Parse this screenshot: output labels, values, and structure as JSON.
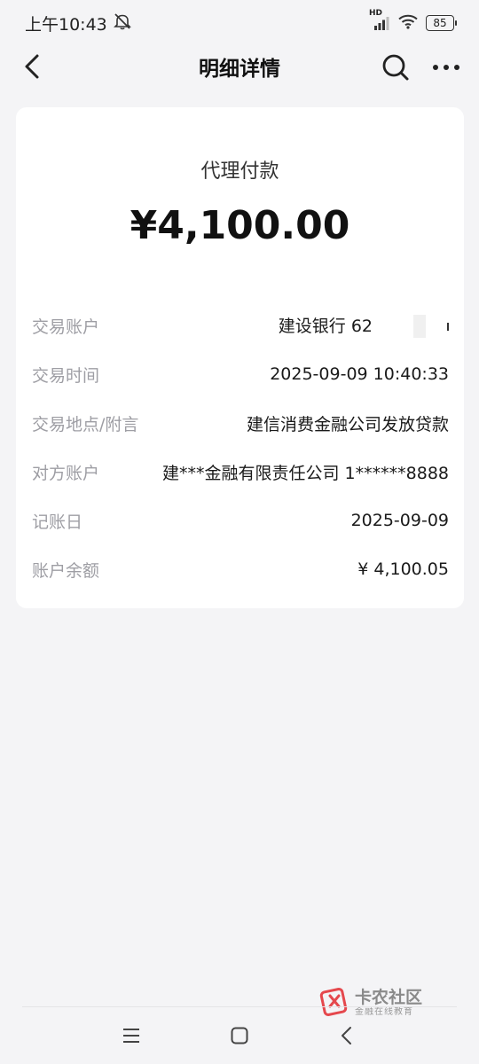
{
  "status_bar": {
    "time": "上午10:43",
    "network_badge": "HD",
    "battery_level": "85"
  },
  "nav": {
    "title": "明细详情",
    "icons": [
      "chevron-left-icon",
      "search-icon",
      "more-icon"
    ]
  },
  "transaction": {
    "type": "代理付款",
    "amount": "¥4,100.00"
  },
  "details": [
    {
      "label": "交易账户",
      "value": "建设银行 62"
    },
    {
      "label": "交易时间",
      "value": "2025-09-09 10:40:33"
    },
    {
      "label": "交易地点/附言",
      "value": "建信消费金融公司发放贷款"
    },
    {
      "label": "对方账户",
      "value": "建***金融有限责任公司 1******8888"
    },
    {
      "label": "记账日",
      "value": "2025-09-09"
    },
    {
      "label": "账户余额",
      "value": "¥ 4,100.05"
    }
  ],
  "watermark": {
    "title": "卡农社区",
    "subtitle": "金融在线教育"
  },
  "bottom_nav": {
    "icons": [
      "menu-icon",
      "home-icon",
      "back-icon"
    ]
  },
  "colors": {
    "background": "#f4f4f6",
    "card": "#ffffff",
    "label": "#9e9ea4",
    "text": "#1a1a1a",
    "watermark_red": "#e5484d"
  }
}
